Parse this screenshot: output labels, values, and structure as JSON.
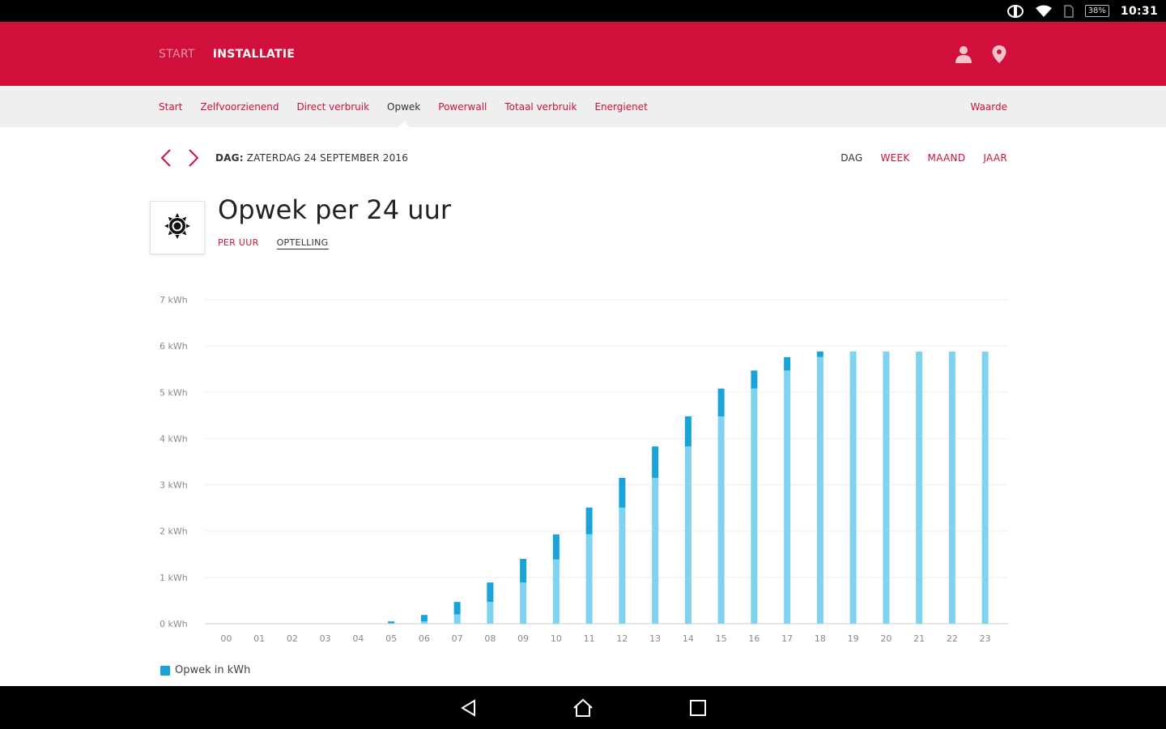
{
  "status_bar": {
    "battery": "38%",
    "time": "10:31"
  },
  "header": {
    "tabs": [
      {
        "label": "START",
        "active": false
      },
      {
        "label": "INSTALLATIE",
        "active": true
      }
    ],
    "icons": [
      "user-icon",
      "location-pin-icon"
    ]
  },
  "subnav": {
    "items": [
      {
        "label": "Start",
        "active": false
      },
      {
        "label": "Zelfvoorzienend",
        "active": false
      },
      {
        "label": "Direct verbruik",
        "active": false
      },
      {
        "label": "Opwek",
        "active": true
      },
      {
        "label": "Powerwall",
        "active": false
      },
      {
        "label": "Totaal verbruik",
        "active": false
      },
      {
        "label": "Energienet",
        "active": false
      }
    ],
    "right_label": "Waarde"
  },
  "date_row": {
    "prefix": "DAG:",
    "date": "ZATERDAG 24 SEPTEMBER 2016",
    "periods": [
      {
        "label": "DAG",
        "active": true
      },
      {
        "label": "WEEK",
        "active": false
      },
      {
        "label": "MAAND",
        "active": false
      },
      {
        "label": "JAAR",
        "active": false
      }
    ]
  },
  "title": "Opwek per 24 uur",
  "title_icon": "sun-icon",
  "modes": [
    {
      "label": "PER UUR",
      "active": false
    },
    {
      "label": "OPTELLING",
      "active": true
    }
  ],
  "colors": {
    "brand": "#d0103a",
    "bar_light": "#7fd3ef",
    "bar_dark": "#1aa3d9",
    "gridline": "#eeeeee"
  },
  "chart_data": {
    "type": "bar",
    "stacked": true,
    "categories": [
      "00",
      "01",
      "02",
      "03",
      "04",
      "05",
      "06",
      "07",
      "08",
      "09",
      "10",
      "11",
      "12",
      "13",
      "14",
      "15",
      "16",
      "17",
      "18",
      "19",
      "20",
      "21",
      "22",
      "23"
    ],
    "series": [
      {
        "values": [
          0,
          0,
          0,
          0,
          0,
          0.01,
          0.05,
          0.2,
          0.47,
          0.89,
          1.39,
          1.93,
          2.51,
          3.15,
          3.83,
          4.48,
          5.08,
          5.47,
          5.76,
          5.88,
          5.88,
          5.88,
          5.88,
          5.88
        ]
      },
      {
        "values": [
          0,
          0,
          0,
          0,
          0,
          0.04,
          0.14,
          0.27,
          0.42,
          0.51,
          0.54,
          0.58,
          0.64,
          0.68,
          0.65,
          0.6,
          0.39,
          0.29,
          0.12,
          0,
          0,
          0,
          0,
          0
        ]
      }
    ],
    "yticks": [
      "0 kWh",
      "1 kWh",
      "2 kWh",
      "3 kWh",
      "4 kWh",
      "5 kWh",
      "6 kWh",
      "7 kWh"
    ],
    "ylim": [
      0,
      7
    ],
    "grid": true,
    "legend": {
      "position": "bottom-left",
      "label": "Opwek in kWh"
    }
  },
  "navbar": [
    "back-icon",
    "home-icon",
    "recents-icon"
  ]
}
